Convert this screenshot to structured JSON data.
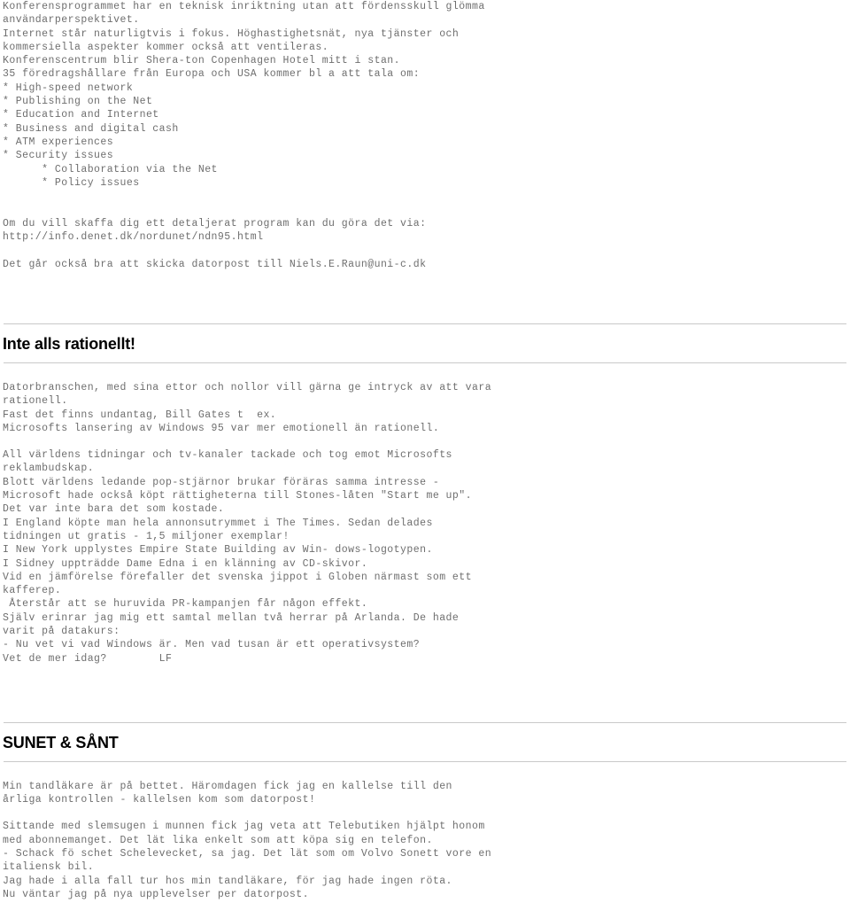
{
  "document": {
    "type": "newsletter-text-page",
    "text_color": "#6e6e6e",
    "heading_color": "#000000",
    "rule_color": "#c9c9c9",
    "background": "#ffffff"
  },
  "intro": {
    "lines": [
      "Konferensprogrammet har en teknisk inriktning utan att fördensskull glömma",
      "användarperspektivet.",
      "Internet står naturligtvis i fokus. Höghastighetsnät, nya tjänster och",
      "kommersiella aspekter kommer också att ventileras.",
      "Konferenscentrum blir Shera-ton Copenhagen Hotel mitt i stan.",
      "35 föredragshållare från Europa och USA kommer bl a att tala om:",
      "* High-speed network",
      "* Publishing on the Net",
      "* Education and Internet",
      "* Business and digital cash",
      "* ATM experiences",
      "* Security issues",
      "      * Collaboration via the Net",
      "      * Policy issues",
      "",
      "",
      "Om du vill skaffa dig ett detaljerat program kan du göra det via:",
      "http://info.denet.dk/nordunet/ndn95.html",
      "",
      "Det går också bra att skicka datorpost till Niels.E.Raun@uni-c.dk"
    ]
  },
  "article_rationellt": {
    "heading": "Inte alls rationellt!",
    "paragraph_1": [
      "Datorbranschen, med sina ettor och nollor vill gärna ge intryck av att vara",
      "rationell.",
      "Fast det finns undantag, Bill Gates t  ex.",
      "Microsofts lansering av Windows 95 var mer emotionell än rationell."
    ],
    "paragraph_2": [
      "All världens tidningar och tv-kanaler tackade och tog emot Microsofts",
      "reklambudskap.",
      "Blott världens ledande pop-stjärnor brukar föräras samma intresse -",
      "Microsoft hade också köpt rättigheterna till Stones-låten \"Start me up\".",
      "Det var inte bara det som kostade.",
      "I England köpte man hela annonsutrymmet i The Times. Sedan delades",
      "tidningen ut gratis - 1,5 miljoner exemplar!",
      "I New York upplystes Empire State Building av Win- dows-logotypen.",
      "I Sidney uppträdde Dame Edna i en klänning av CD-skivor.",
      "Vid en jämförelse förefaller det svenska jippot i Globen närmast som ett",
      "kafferep.",
      " Återstår att se huruvida PR-kampanjen får någon effekt.",
      "Själv erinrar jag mig ett samtal mellan två herrar på Arlanda. De hade",
      "varit på datakurs:",
      "- Nu vet vi vad Windows är. Men vad tusan är ett operativsystem?",
      "Vet de mer idag?        LF"
    ]
  },
  "article_sunet": {
    "heading": "SUNET & SÅNT",
    "paragraph_1": [
      "Min tandläkare är på bettet. Häromdagen fick jag en kallelse till den",
      "årliga kontrollen - kallelsen kom som datorpost!"
    ],
    "paragraph_2": [
      "Sittande med slemsugen i munnen fick jag veta att Telebutiken hjälpt honom",
      "med abonnemanget. Det lät lika enkelt som att köpa sig en telefon.",
      "- Schack fö schet Schelevecket, sa jag. Det lät som om Volvo Sonett vore en",
      "italiensk bil.",
      "Jag hade i alla fall tur hos min tandläkare, för jag hade ingen röta.",
      "Nu väntar jag på nya upplevelser per datorpost."
    ]
  }
}
